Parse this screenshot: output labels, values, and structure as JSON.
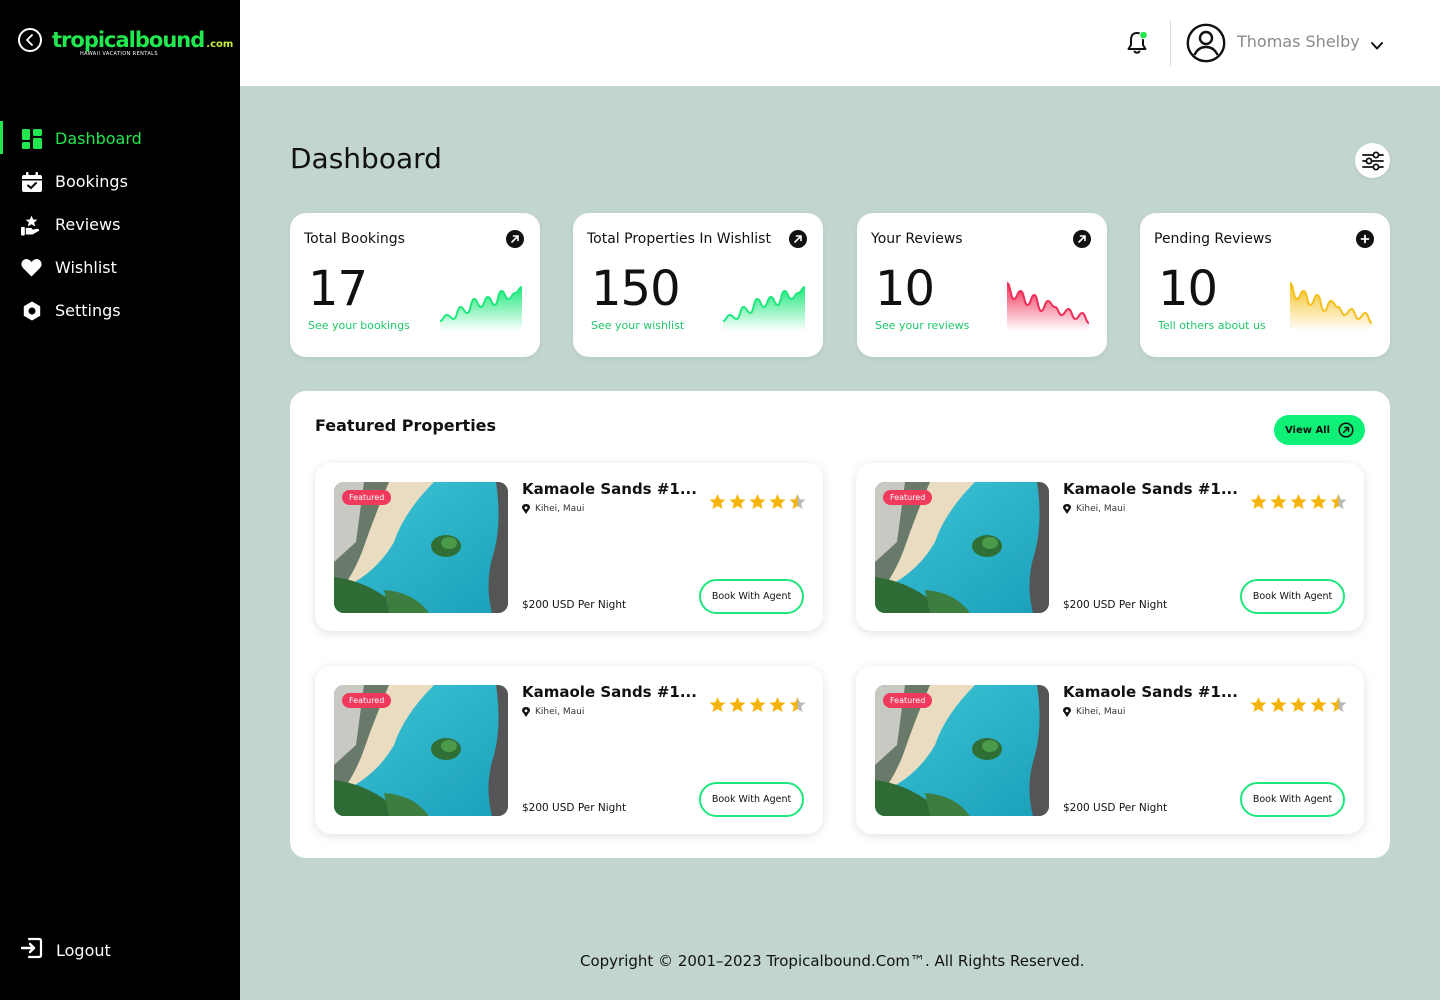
{
  "brand": {
    "logo_main": "tropicalbound",
    "logo_com": ".com",
    "logo_tagline": "HAWAII VACATION RENTALS",
    "accent_color": "#22e84f"
  },
  "sidebar": {
    "items": [
      {
        "label": "Dashboard",
        "icon": "dashboard-grid-icon",
        "active": true
      },
      {
        "label": "Bookings",
        "icon": "calendar-check-icon",
        "active": false
      },
      {
        "label": "Reviews",
        "icon": "hand-star-icon",
        "active": false
      },
      {
        "label": "Wishlist",
        "icon": "heart-icon",
        "active": false
      },
      {
        "label": "Settings",
        "icon": "gear-icon",
        "active": false
      }
    ],
    "logout_label": "Logout"
  },
  "header": {
    "user_name": "Thomas Shelby",
    "notification_dot_color": "#22e84f"
  },
  "page": {
    "title": "Dashboard"
  },
  "stats": [
    {
      "title": "Total Bookings",
      "value": "17",
      "link": "See your bookings",
      "link_color": "#20c76a",
      "chart_color": "#1ee87c",
      "action_icon": "arrow-up-right-icon"
    },
    {
      "title": "Total Properties In Wishlist",
      "value": "150",
      "link": "See your wishlist",
      "link_color": "#20c76a",
      "chart_color": "#1ee87c",
      "action_icon": "arrow-up-right-icon"
    },
    {
      "title": "Your Reviews",
      "value": "10",
      "link": "See your reviews",
      "link_color": "#20c76a",
      "chart_color": "#ef2e58",
      "action_icon": "arrow-up-right-icon"
    },
    {
      "title": "Pending Reviews",
      "value": "10",
      "link": "Tell others about us",
      "link_color": "#20c76a",
      "chart_color": "#f5c01e",
      "action_icon": "plus-icon"
    }
  ],
  "featured": {
    "title": "Featured Properties",
    "view_all_label": "View All",
    "properties": [
      {
        "badge": "Featured",
        "name": "Kamaole Sands #1...",
        "location": "Kihei, Maui",
        "price": "$200 USD Per Night",
        "rating": 4.5,
        "button": "Book With Agent"
      },
      {
        "badge": "Featured",
        "name": "Kamaole Sands #1...",
        "location": "Kihei, Maui",
        "price": "$200 USD Per Night",
        "rating": 4.5,
        "button": "Book With Agent"
      },
      {
        "badge": "Featured",
        "name": "Kamaole Sands #1...",
        "location": "Kihei, Maui",
        "price": "$200 USD Per Night",
        "rating": 4.5,
        "button": "Book With Agent"
      },
      {
        "badge": "Featured",
        "name": "Kamaole Sands #1...",
        "location": "Kihei, Maui",
        "price": "$200 USD Per Night",
        "rating": 4.5,
        "button": "Book With Agent"
      }
    ]
  },
  "footer": {
    "copyright": "Copyright © 2001–2023 Tropicalbound.Com™. All Rights Reserved."
  }
}
